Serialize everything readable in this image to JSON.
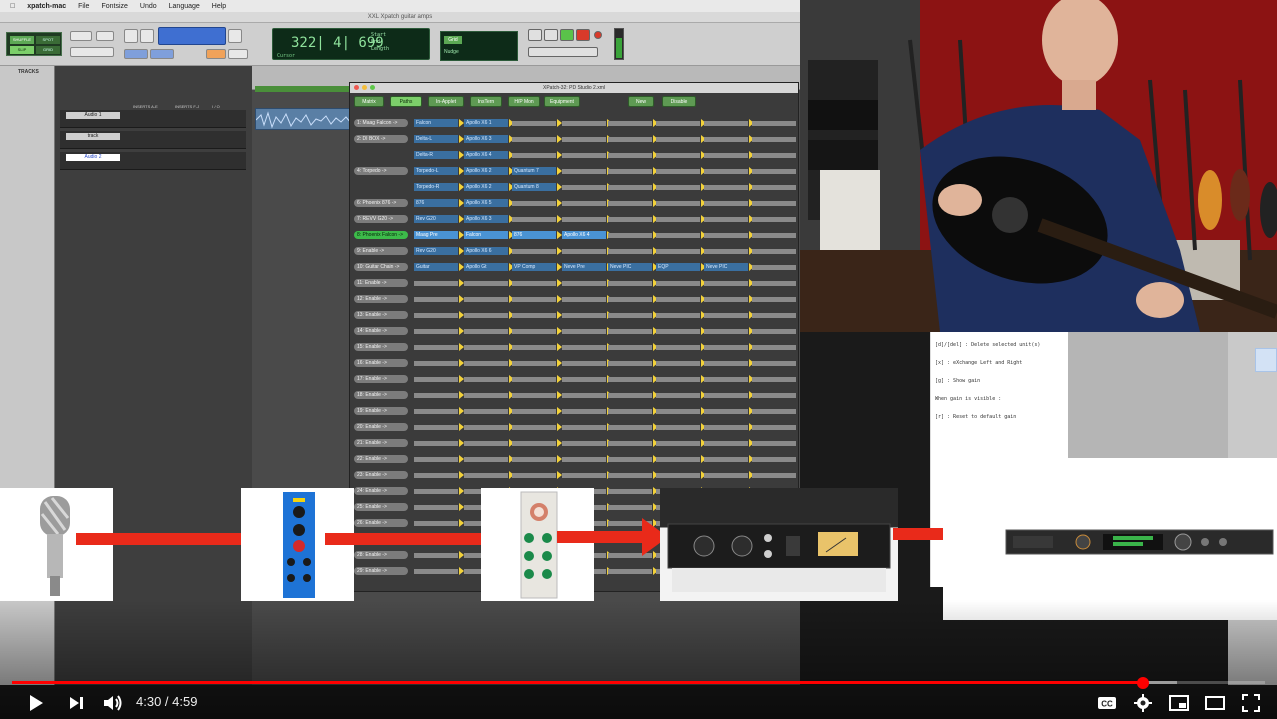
{
  "menubar": {
    "app": "xpatch-mac",
    "items": [
      "File",
      "Fontsize",
      "Undo",
      "Language",
      "Help"
    ]
  },
  "protools": {
    "title": "XXL Xpatch guitar amps",
    "counter": {
      "main": "322| 4| 699",
      "sub_label": "Cursor",
      "start_label": "Start",
      "end_label": "End",
      "length_label": "Length"
    },
    "mode_labels": [
      "SHUFFLE",
      "SPOT",
      "SLIP",
      "GRID"
    ],
    "grid_label": "Grid",
    "nudge_label": "Nudge",
    "tracks_header": "TRACKS",
    "ruler_labels": [
      "Bars|Beats",
      "Min:Secs",
      "Tempo",
      "Markers"
    ],
    "mix_header": [
      "INSERTS A-E",
      "INSERTS F-J",
      "I / O"
    ],
    "tracks": [
      {
        "name": "Audio 1",
        "selected": false
      },
      {
        "name": "track",
        "selected": false
      },
      {
        "name": "Audio 2",
        "selected": true
      }
    ]
  },
  "xpatch": {
    "title": "XPatch-32: PD Studio 2.xml",
    "tabs": [
      "Matrix",
      "Paths",
      "In-Applet",
      "InsTern",
      "H/P Mon",
      "Equipment",
      "New",
      "Disable"
    ],
    "active_tab": "Paths",
    "rows": [
      {
        "label": "1: Maag Falcon ->",
        "units": [
          "Falcon",
          "Apollo X6 1"
        ]
      },
      {
        "label": "2: DI BOX ->",
        "units": [
          "Delta-L",
          "Apollo X6 3"
        ]
      },
      {
        "label": "",
        "units": [
          "Delta-R",
          "Apollo X6 4"
        ]
      },
      {
        "label": "4: Torpedo ->",
        "units": [
          "Torpedo-L",
          "Apollo X6 2",
          "Quantum 7"
        ]
      },
      {
        "label": "",
        "units": [
          "Torpedo-R",
          "Apollo X6 2",
          "Quantum 8"
        ]
      },
      {
        "label": "6: Phoenix 876 ->",
        "units": [
          "876",
          "Apollo X6 5"
        ]
      },
      {
        "label": "7: REVV G20 ->",
        "units": [
          "Rev G20",
          "Apollo X6 3"
        ]
      },
      {
        "label": "8: Phoenix Falcon ->",
        "units": [
          "Maag Pre",
          "Falcon",
          "876",
          "Apollo X6 4"
        ],
        "highlight": true
      },
      {
        "label": "9: Enable ->",
        "units": [
          "Rev G20",
          "Apollo X6 6"
        ]
      },
      {
        "label": "10: Guitar Chain ->",
        "units": [
          "Guitar",
          "Apollo Gt",
          "VP Comp",
          "Neve Pre",
          "Neve PIC",
          "EQP",
          "Neve PIC"
        ]
      },
      {
        "label": "11: Enable ->",
        "units": []
      },
      {
        "label": "12: Enable ->",
        "units": []
      },
      {
        "label": "13: Enable ->",
        "units": []
      },
      {
        "label": "14: Enable ->",
        "units": []
      },
      {
        "label": "15: Enable ->",
        "units": []
      },
      {
        "label": "16: Enable ->",
        "units": []
      },
      {
        "label": "17: Enable ->",
        "units": []
      },
      {
        "label": "18: Enable ->",
        "units": []
      },
      {
        "label": "19: Enable ->",
        "units": []
      },
      {
        "label": "20: Enable ->",
        "units": []
      },
      {
        "label": "21: Enable ->",
        "units": []
      },
      {
        "label": "22: Enable ->",
        "units": []
      },
      {
        "label": "23: Enable ->",
        "units": []
      },
      {
        "label": "24: Enable ->",
        "units": []
      },
      {
        "label": "25: Enable ->",
        "units": []
      },
      {
        "label": "26: Enable ->",
        "units": []
      },
      {
        "label": "27: Enable ->",
        "units": []
      },
      {
        "label": "28: Enable ->",
        "units": []
      },
      {
        "label": "29: Enable ->",
        "units": []
      }
    ]
  },
  "help": {
    "lines": [
      "[d]/[del]  : Delete selected unit(s)",
      "[x]        : eXchange Left and Right",
      "[g]        : Show gain",
      "When gain is visible :",
      "[r]        : Reset to default gain"
    ]
  },
  "signal_chain": [
    "microphone",
    "mic-preamp-module",
    "compressor-module",
    "tube-compressor-rack",
    "audio-interface-rack"
  ],
  "player": {
    "current_time": "4:30",
    "separator": " / ",
    "duration": "4:59",
    "progress_fraction": 0.903,
    "buffered_fraction": 0.93,
    "accent_color": "#ff0000",
    "controls": [
      "play-icon",
      "next-icon",
      "volume-icon",
      "cc-icon",
      "settings-icon",
      "miniplayer-icon",
      "theater-icon",
      "fullscreen-icon"
    ]
  }
}
